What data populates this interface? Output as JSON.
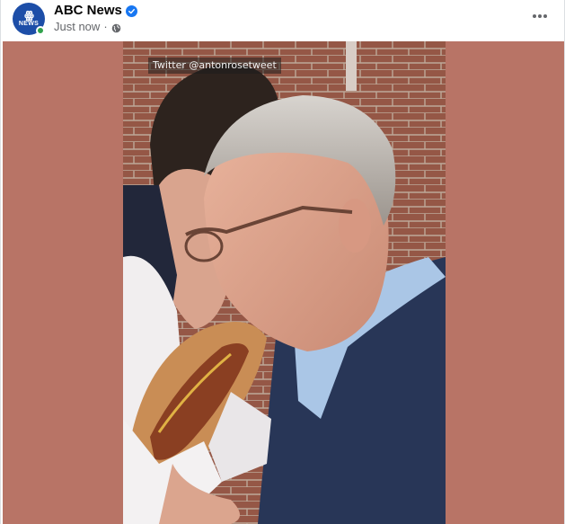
{
  "post": {
    "page_name": "ABC News",
    "timestamp": "Just now",
    "separator": "·",
    "avatar": {
      "logo_mark": "ꙮ",
      "logo_text": "NEWS",
      "brand_color": "#1d4ea8"
    },
    "icons": {
      "verified": "verified-badge-icon",
      "audience": "globe-icon",
      "menu": "more-options-icon"
    }
  },
  "video": {
    "watermark": "Twitter @antonrosetweet",
    "background_color": "#b87466"
  }
}
